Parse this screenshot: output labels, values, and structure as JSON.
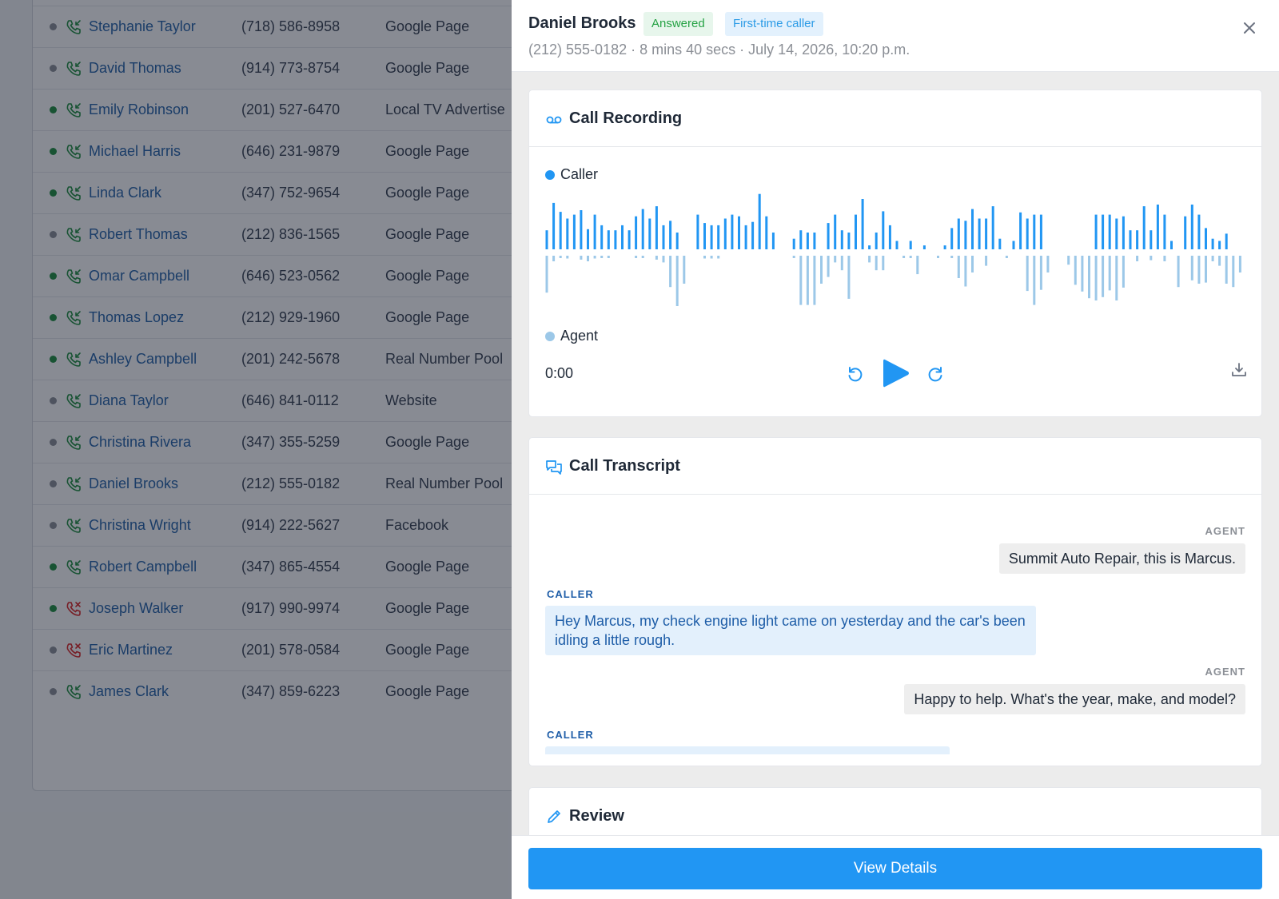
{
  "colors": {
    "accent": "#2196f3",
    "caller_wave": "#2196f3",
    "agent_wave": "#9cc8e8",
    "answered_dot": "#1e8e3e",
    "unanswered_dot": "#8b8f96",
    "missed_icon": "#dc2626",
    "answered_icon": "#1e8e3e"
  },
  "calls": [
    {
      "name": "Stephanie Taylor",
      "number": "(718) 586-8958",
      "source": "Google Page",
      "status": "gray",
      "icon": "phone-incoming-icon"
    },
    {
      "name": "David Thomas",
      "number": "(914) 773-8754",
      "source": "Google Page",
      "status": "gray",
      "icon": "phone-incoming-icon"
    },
    {
      "name": "Emily Robinson",
      "number": "(201) 527-6470",
      "source": "Local TV Advertise",
      "status": "green",
      "icon": "phone-incoming-icon"
    },
    {
      "name": "Michael Harris",
      "number": "(646) 231-9879",
      "source": "Google Page",
      "status": "green",
      "icon": "phone-incoming-icon"
    },
    {
      "name": "Linda Clark",
      "number": "(347) 752-9654",
      "source": "Google Page",
      "status": "green",
      "icon": "phone-incoming-icon"
    },
    {
      "name": "Robert Thomas",
      "number": "(212) 836-1565",
      "source": "Google Page",
      "status": "gray",
      "icon": "phone-incoming-icon"
    },
    {
      "name": "Omar Campbell",
      "number": "(646) 523-0562",
      "source": "Google Page",
      "status": "green",
      "icon": "phone-incoming-icon"
    },
    {
      "name": "Thomas Lopez",
      "number": "(212) 929-1960",
      "source": "Google Page",
      "status": "green",
      "icon": "phone-incoming-icon"
    },
    {
      "name": "Ashley Campbell",
      "number": "(201) 242-5678",
      "source": "Real Number Pool",
      "status": "green",
      "icon": "phone-incoming-icon"
    },
    {
      "name": "Diana Taylor",
      "number": "(646) 841-0112",
      "source": "Website",
      "status": "gray",
      "icon": "phone-incoming-icon"
    },
    {
      "name": "Christina Rivera",
      "number": "(347) 355-5259",
      "source": "Google Page",
      "status": "gray",
      "icon": "phone-incoming-icon"
    },
    {
      "name": "Daniel Brooks",
      "number": "(212) 555-0182",
      "source": "Real Number Pool",
      "status": "gray",
      "icon": "phone-incoming-icon"
    },
    {
      "name": "Christina Wright",
      "number": "(914) 222-5627",
      "source": "Facebook",
      "status": "gray",
      "icon": "phone-incoming-icon"
    },
    {
      "name": "Robert Campbell",
      "number": "(347) 865-4554",
      "source": "Google Page",
      "status": "green",
      "icon": "phone-incoming-icon"
    },
    {
      "name": "Joseph Walker",
      "number": "(917) 990-9974",
      "source": "Google Page",
      "status": "green",
      "icon": "phone-missed-icon"
    },
    {
      "name": "Eric Martinez",
      "number": "(201) 578-0584",
      "source": "Google Page",
      "status": "gray",
      "icon": "phone-missed-icon"
    },
    {
      "name": "James Clark",
      "number": "(347) 859-6223",
      "source": "Google Page",
      "status": "gray",
      "icon": "phone-incoming-icon"
    }
  ],
  "drawer": {
    "caller_name": "Daniel Brooks",
    "badge_status": "Answered",
    "badge_type": "First-time caller",
    "subtitle": "(212) 555-0182 · 8 mins 40 secs · July 14, 2026, 10:20 p.m.",
    "close_icon": "close-icon"
  },
  "recording": {
    "title": "Call Recording",
    "icon": "voicemail-icon",
    "legend_caller": "Caller",
    "legend_agent": "Agent",
    "current_time": "0:00",
    "controls": [
      "rewind-icon",
      "play-icon",
      "forward-icon",
      "download-icon"
    ],
    "caller_wave": [
      0.34,
      0.83,
      0.67,
      0.55,
      0.62,
      0.7,
      0.36,
      0.62,
      0.43,
      0.34,
      0.34,
      0.43,
      0.34,
      0.59,
      0.72,
      0.55,
      0.77,
      0.43,
      0.51,
      0.3,
      0,
      0,
      0.62,
      0.47,
      0.43,
      0.43,
      0.55,
      0.62,
      0.59,
      0.43,
      0.49,
      0.99,
      0.59,
      0.3,
      0,
      0,
      0.19,
      0.34,
      0.3,
      0.3,
      0,
      0.47,
      0.62,
      0.34,
      0.3,
      0.62,
      0.9,
      0.07,
      0.3,
      0.68,
      0.43,
      0.15,
      0,
      0.15,
      0,
      0.07,
      0,
      0,
      0.07,
      0.38,
      0.55,
      0.51,
      0.72,
      0.55,
      0.55,
      0.77,
      0.19,
      0,
      0.15,
      0.66,
      0.55,
      0.62,
      0.62,
      0,
      0,
      0,
      0,
      0,
      0,
      0,
      0.62,
      0.62,
      0.62,
      0.55,
      0.59,
      0.34,
      0.34,
      0.77,
      0.34,
      0.8,
      0.62,
      0.15,
      0,
      0.59,
      0.8,
      0.62,
      0.38,
      0.19,
      0.15,
      0.28
    ],
    "agent_wave": [
      0.66,
      0.1,
      0.04,
      0.05,
      0,
      0.07,
      0.1,
      0.05,
      0.04,
      0.04,
      0,
      0,
      0,
      0.04,
      0.04,
      0,
      0.07,
      0.12,
      0.56,
      0.9,
      0.5,
      0,
      0,
      0.05,
      0.05,
      0.05,
      0,
      0,
      0,
      0,
      0,
      0,
      0,
      0,
      0,
      0,
      0.04,
      0.88,
      0.88,
      0.88,
      0.5,
      0.38,
      0.12,
      0.26,
      0.77,
      0,
      0,
      0.12,
      0.26,
      0.26,
      0,
      0,
      0.04,
      0.04,
      0.33,
      0,
      0,
      0.04,
      0,
      0.03,
      0.4,
      0.55,
      0.3,
      0,
      0.18,
      0,
      0,
      0.04,
      0,
      0,
      0.63,
      0.88,
      0.61,
      0.3,
      0,
      0,
      0.16,
      0.52,
      0.64,
      0.76,
      0.8,
      0.74,
      0.62,
      0.8,
      0.57,
      0,
      0.1,
      0,
      0.08,
      0,
      0.1,
      0,
      0.56,
      0,
      0.44,
      0.5,
      0.48,
      0.1,
      0.18,
      0.5,
      0.56,
      0.3
    ]
  },
  "transcript": {
    "title": "Call Transcript",
    "icon": "chat-icon",
    "messages": [
      {
        "speaker": "AGENT",
        "text": "Summit Auto Repair, this is Marcus."
      },
      {
        "speaker": "CALLER",
        "text": "Hey Marcus, my check engine light came on yesterday and the car's been idling a little rough."
      },
      {
        "speaker": "AGENT",
        "text": "Happy to help. What's the year, make, and model?"
      },
      {
        "speaker": "CALLER",
        "text": ""
      }
    ]
  },
  "review": {
    "title": "Review",
    "icon": "pencil-icon"
  },
  "footer": {
    "cta_label": "View Details"
  }
}
